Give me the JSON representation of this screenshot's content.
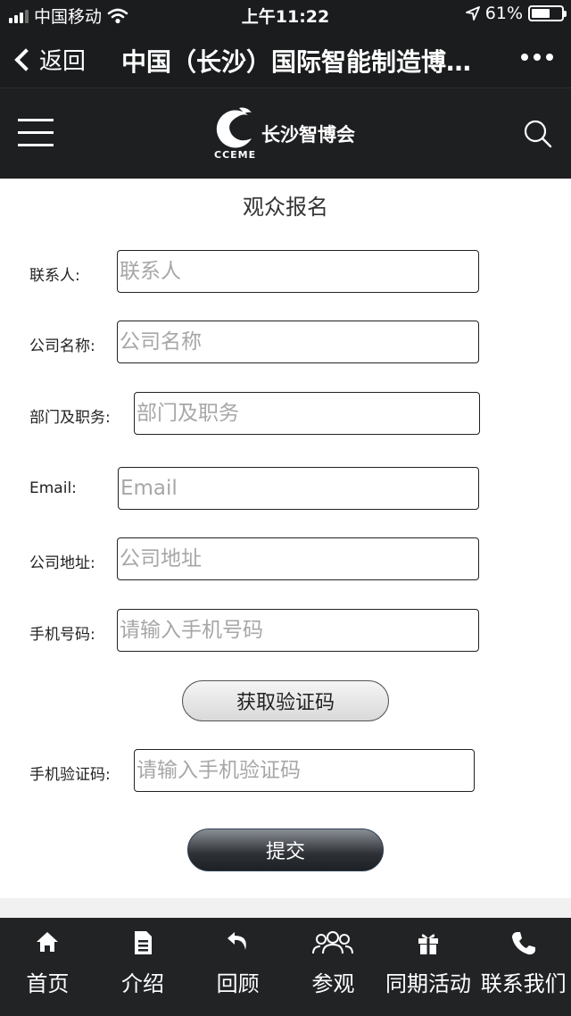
{
  "status_bar": {
    "carrier": "中国移动",
    "time": "上午11:22",
    "battery": "61%",
    "battery_level": 0.61
  },
  "nav_bar": {
    "back_label": "返回",
    "title": "中国（长沙）国际智能制造博…"
  },
  "site_header": {
    "logo_text": "长沙智博会",
    "logo_sub": "CCEME"
  },
  "form": {
    "title": "观众报名",
    "fields": [
      {
        "label": "联系人:",
        "placeholder": "联系人"
      },
      {
        "label": "公司名称:",
        "placeholder": "公司名称"
      },
      {
        "label": "部门及职务:",
        "placeholder": "部门及职务"
      },
      {
        "label": "Email:",
        "placeholder": "Email"
      },
      {
        "label": "公司地址:",
        "placeholder": "公司地址"
      },
      {
        "label": "手机号码:",
        "placeholder": "请输入手机号码"
      }
    ],
    "get_code_label": "获取验证码",
    "verify": {
      "label": "手机验证码:",
      "placeholder": "请输入手机验证码"
    },
    "submit_label": "提交"
  },
  "tabs": [
    {
      "label": "首页",
      "icon": "home-icon"
    },
    {
      "label": "介绍",
      "icon": "document-icon"
    },
    {
      "label": "回顾",
      "icon": "undo-icon"
    },
    {
      "label": "参观",
      "icon": "group-icon"
    },
    {
      "label": "同期活动",
      "icon": "gift-icon"
    },
    {
      "label": "联系我们",
      "icon": "phone-icon"
    }
  ],
  "colors": {
    "header_bg": "#1e1f21",
    "tab_bar_bg": "#222325",
    "placeholder": "#a7a7a7"
  }
}
